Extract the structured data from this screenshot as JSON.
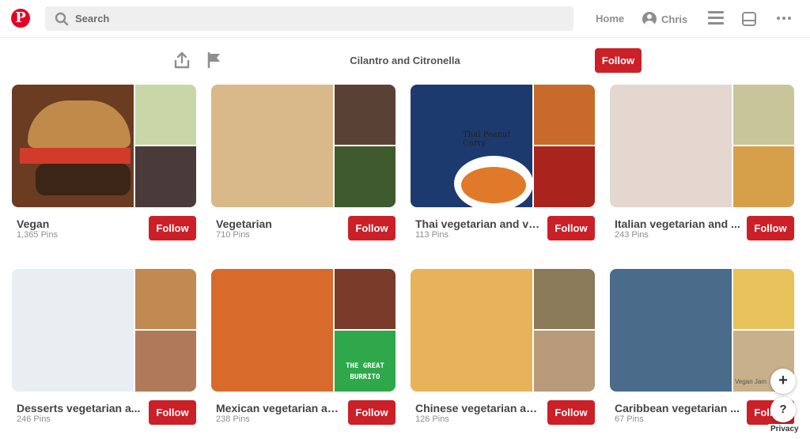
{
  "header": {
    "logo": "P",
    "search_placeholder": "Search",
    "home": "Home",
    "user": "Chris"
  },
  "profile": {
    "name": "Cilantro and Citronella",
    "follow": "Follow"
  },
  "boards": [
    {
      "title": "Vegan",
      "count": "1,365 Pins",
      "follow": "Follow",
      "colors": [
        "#6b3b22",
        "#c9d6a8",
        "#4a3b3b"
      ]
    },
    {
      "title": "Vegetarian",
      "count": "710 Pins",
      "follow": "Follow",
      "colors": [
        "#d9b98a",
        "#5a4136",
        "#3f5a2c"
      ]
    },
    {
      "title": "Thai vegetarian and ve...",
      "count": "113 Pins",
      "follow": "Follow",
      "colors": [
        "#1c3a6e",
        "#c86b2a",
        "#a8241c"
      ]
    },
    {
      "title": "Italian vegetarian and ...",
      "count": "243 Pins",
      "follow": "Follow",
      "colors": [
        "#e3d7cf",
        "#c8c59a",
        "#d6a04a"
      ]
    },
    {
      "title": "Desserts vegetarian a...",
      "count": "246 Pins",
      "follow": "Follow",
      "colors": [
        "#e8eef2",
        "#c08a52",
        "#b07a5a"
      ]
    },
    {
      "title": "Mexican vegetarian an...",
      "count": "238 Pins",
      "follow": "Follow",
      "colors": [
        "#d86b2c",
        "#7a3b2a",
        "#2ea84a"
      ]
    },
    {
      "title": "Chinese vegetarian an...",
      "count": "126 Pins",
      "follow": "Follow",
      "colors": [
        "#e8b25a",
        "#8a7a5a",
        "#b89a7a"
      ]
    },
    {
      "title": "Caribbean vegetarian ...",
      "count": "67 Pins",
      "follow": "Follow",
      "colors": [
        "#4a6b8a",
        "#e8c25a",
        "#c8b08a"
      ]
    }
  ],
  "burrito_label": "THE GREAT BURRITO",
  "thai_label": "Thai Peanut Curry",
  "caribbean_label": "Vegan Jam",
  "fab": {
    "add": "+",
    "help": "?"
  },
  "privacy": "Privacy"
}
